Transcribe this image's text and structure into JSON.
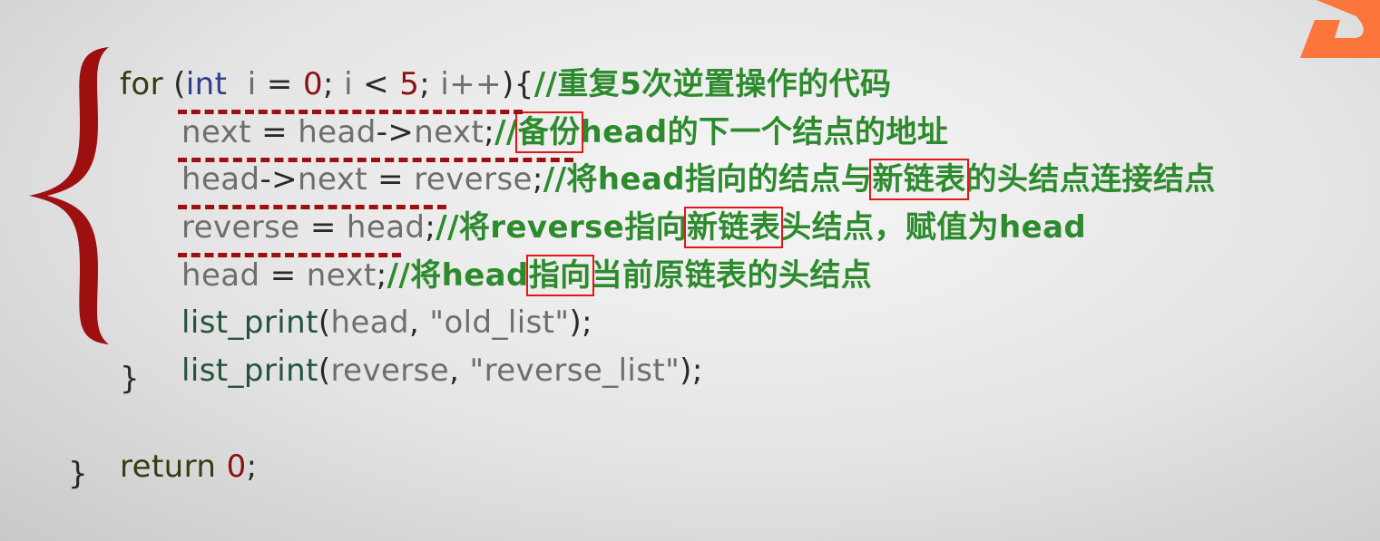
{
  "code": {
    "for_kw": "for",
    "open_paren": " (",
    "int_kw": "int",
    "i_var": "  i",
    "assign_op": " = ",
    "init_val": "0",
    "semi1": "; ",
    "i_var2": "i",
    "lt_op": " < ",
    "limit_val": "5",
    "semi2": "; ",
    "inc_expr": "i++",
    "close_brace_open": "){",
    "comment_loop": "//重复5次逆置操作的代码",
    "l2_next": "next",
    "l2_eq": " = ",
    "l2_head": "head",
    "l2_arrow": "->",
    "l2_next2": "next",
    "l2_semi": ";",
    "c2_prefix": "//",
    "c2_box": "备份",
    "c2_rest": "head的下一个结点的地址",
    "l3_head": "head",
    "l3_arrow": "->",
    "l3_next": "next",
    "l3_eq": " = ",
    "l3_reverse": "reverse",
    "l3_semi": ";",
    "c3_prefix": "//将head指向的结点与",
    "c3_box": "新链表",
    "c3_rest": "的头结点连接结点",
    "l4_reverse": "reverse",
    "l4_eq": " = ",
    "l4_head": "head",
    "l4_semi": ";",
    "c4_prefix": "//将reverse指向",
    "c4_box": "新链表",
    "c4_rest": "头结点，赋值为head",
    "l5_head": "head",
    "l5_eq": " = ",
    "l5_next": "next",
    "l5_semi": ";",
    "c5_prefix": "//将head",
    "c5_box": "指向",
    "c5_rest": "当前原链表的头结点",
    "l6_fn": "list_print",
    "l6_open": "(",
    "l6_arg1": "head",
    "l6_comma": ", ",
    "l6_str": "\"old_list\"",
    "l6_close": ");",
    "l7_fn": "list_print",
    "l7_open": "(",
    "l7_arg1": "reverse",
    "l7_comma": ", ",
    "l7_str": "\"reverse_list\"",
    "l7_close": ");",
    "loop_close": "}",
    "return_kw": "return",
    "return_val": "0",
    "return_semi": ";",
    "func_close": "}"
  },
  "colors": {
    "keyword": "#3a3a14",
    "type": "#2e3f8a",
    "number": "#8b1010",
    "identifier": "#6e6e6e",
    "function": "#24543c",
    "comment": "#2d8a2d",
    "highlight_box": "#e01818",
    "underline": "#9e1010",
    "brace": "#9e1010",
    "logo": "#ff6a2a"
  }
}
